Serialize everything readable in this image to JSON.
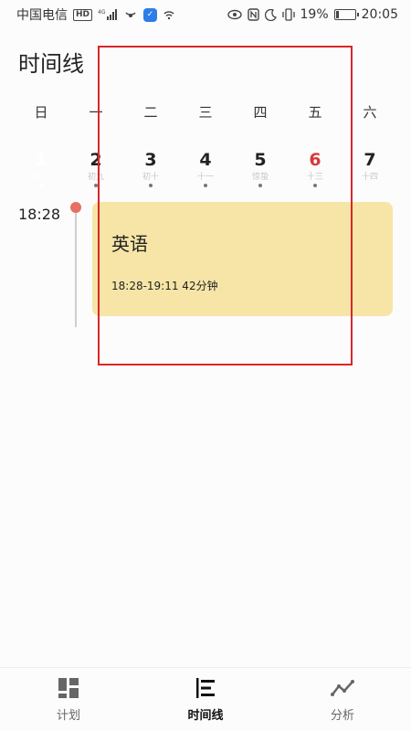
{
  "status_bar": {
    "carrier": "中国电信",
    "hd": "HD",
    "network": "4G",
    "battery": "19%",
    "battery_level": 0.19,
    "time": "20:05"
  },
  "header": {
    "title": "时间线"
  },
  "week": {
    "weekdays": [
      "日",
      "一",
      "二",
      "三",
      "四",
      "五",
      "六"
    ],
    "days": [
      {
        "num": "1",
        "lunar": "初八",
        "selected": true,
        "red": false,
        "dot": true
      },
      {
        "num": "2",
        "lunar": "初九",
        "selected": false,
        "red": false,
        "dot": true
      },
      {
        "num": "3",
        "lunar": "初十",
        "selected": false,
        "red": false,
        "dot": true
      },
      {
        "num": "4",
        "lunar": "十一",
        "selected": false,
        "red": false,
        "dot": true
      },
      {
        "num": "5",
        "lunar": "惊蛰",
        "selected": false,
        "red": false,
        "dot": true
      },
      {
        "num": "6",
        "lunar": "十三",
        "selected": false,
        "red": true,
        "dot": true
      },
      {
        "num": "7",
        "lunar": "十四",
        "selected": false,
        "red": false,
        "dot": false
      }
    ]
  },
  "timeline": {
    "time": "18:28",
    "event": {
      "title": "英语",
      "time_range": "18:28-19:11 42分钟"
    }
  },
  "nav": {
    "items": [
      {
        "label": "计划",
        "icon": "dashboard-icon",
        "active": false
      },
      {
        "label": "时间线",
        "icon": "timeline-icon",
        "active": true
      },
      {
        "label": "分析",
        "icon": "line-chart-icon",
        "active": false
      }
    ]
  },
  "colors": {
    "selected_day": "#ef7b22",
    "event_card": "#f6e5a6",
    "timeline_dot": "#e67061",
    "highlight": "#d9272a"
  }
}
